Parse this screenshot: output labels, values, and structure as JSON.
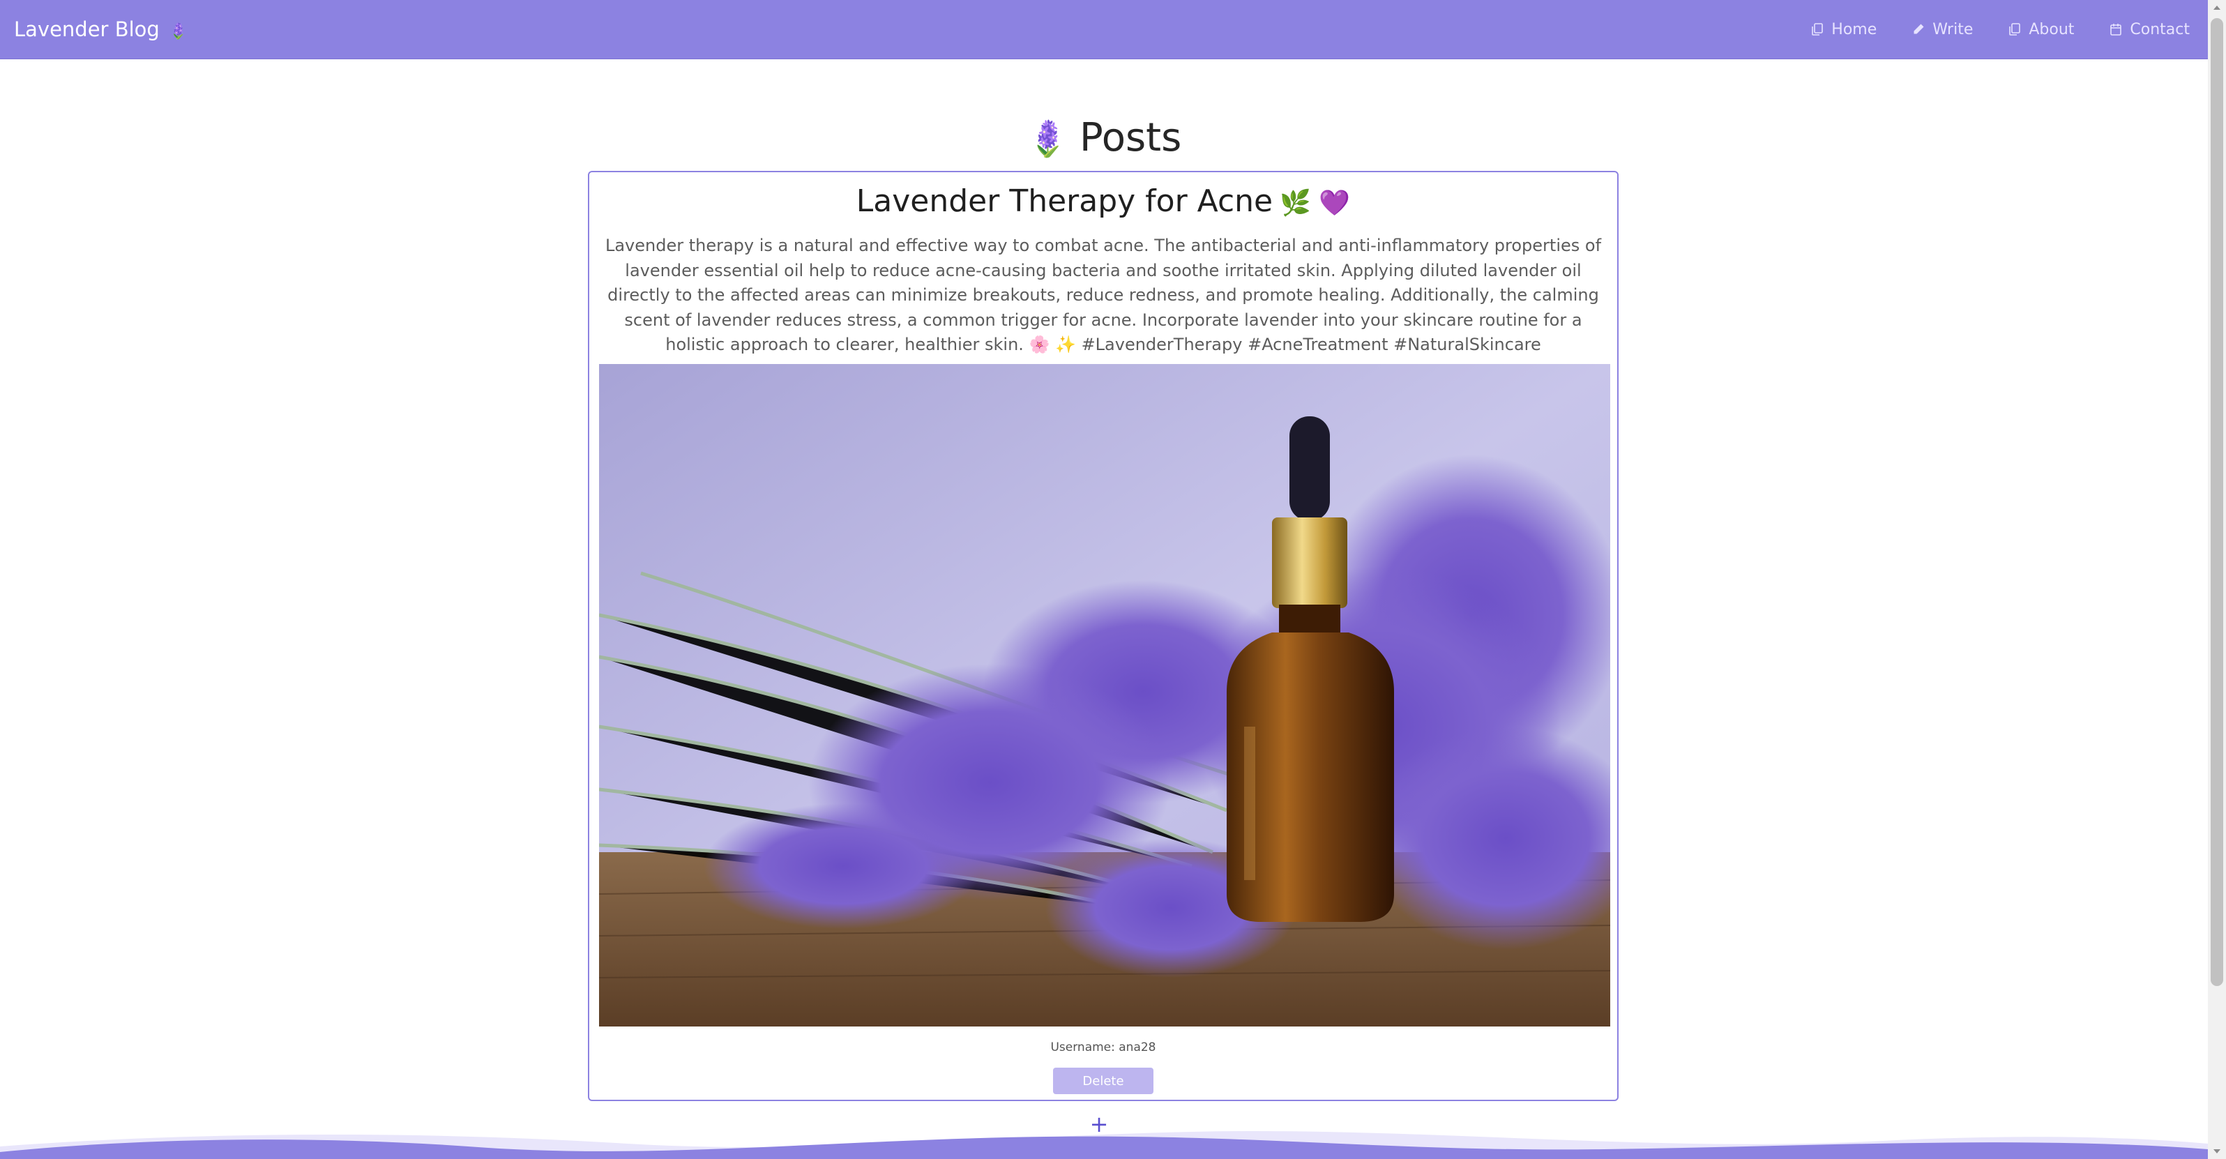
{
  "header": {
    "brand": "Lavender Blog",
    "brand_icon": "lavender-flower-icon",
    "nav": [
      {
        "label": "Home",
        "icon": "copy-icon"
      },
      {
        "label": "Write",
        "icon": "pencil-icon"
      },
      {
        "label": "About",
        "icon": "copy-icon"
      },
      {
        "label": "Contact",
        "icon": "calendar-icon"
      }
    ]
  },
  "main": {
    "title": "Posts",
    "title_icon": "lavender-flower-icon"
  },
  "post": {
    "title": "Lavender Therapy for Acne",
    "title_emoji": "🌿 💜",
    "body": "Lavender therapy is a natural and effective way to combat acne. The antibacterial and anti-inflammatory properties of lavender essential oil help to reduce acne-causing bacteria and soothe irritated skin. Applying diluted lavender oil directly to the affected areas can minimize breakouts, reduce redness, and promote healing. Additionally, the calming scent of lavender reduces stress, a common trigger for acne. Incorporate lavender into your skincare routine for a holistic approach to clearer, healthier skin. 🌸 ✨ #LavenderTherapy #AcneTreatment #NaturalSkincare",
    "image_subject": "amber dropper bottle of lavender essential oil among lavender sprigs on wooden table",
    "username": "Username: ana28",
    "delete_label": "Delete"
  },
  "add_label": "+",
  "colors": {
    "navbar": "#8c82e1",
    "card_border": "#8c82e1",
    "delete_button": "#bdb5ef",
    "add_button": "#5a4fcf",
    "wave_light": "#e9e6fb",
    "wave_dark": "#8c82e1"
  }
}
